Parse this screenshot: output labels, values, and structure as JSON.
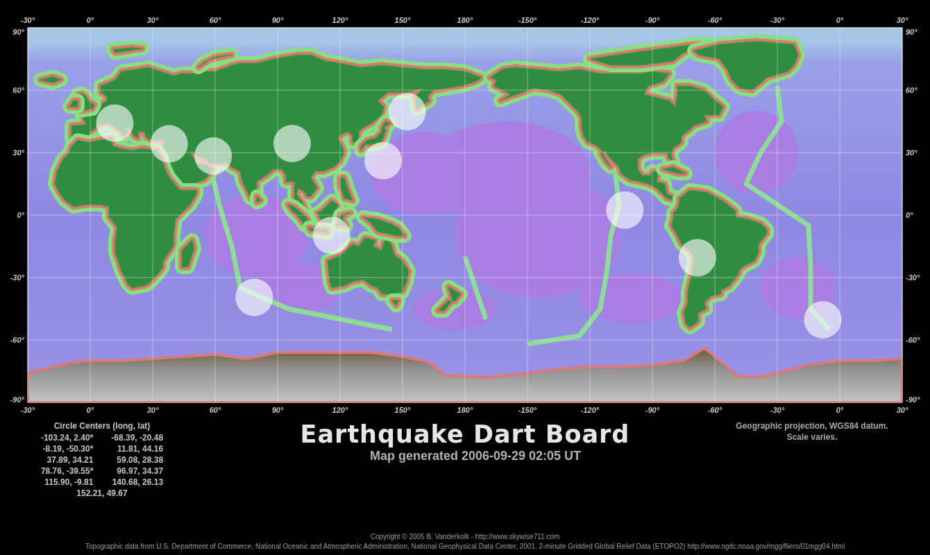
{
  "map": {
    "top_axis_labels": [
      "-30°",
      "0°",
      "30°",
      "60°",
      "90°",
      "120°",
      "150°",
      "180°",
      "-150°",
      "-120°",
      "-90°",
      "-60°",
      "-30°",
      "0°",
      "30°"
    ],
    "bottom_axis_labels": [
      "-30°",
      "0°",
      "30°",
      "60°",
      "90°",
      "120°",
      "150°",
      "180°",
      "-150°",
      "-120°",
      "-90°",
      "-60°",
      "-30°",
      "0°",
      "30°"
    ],
    "left_axis_labels": [
      "90°",
      "60°",
      "30°",
      "0°",
      "-30°",
      "-60°",
      "-90°"
    ],
    "right_axis_labels": [
      "90°",
      "60°",
      "30°",
      "0°",
      "-30°",
      "-60°",
      "-90°"
    ]
  },
  "legend": {
    "title": "Circle Centers (long, lat)",
    "entries": [
      "-103.24, 2.40*",
      "-68.39, -20.48",
      "-8.19, -50.30*",
      "11.81, 44.16",
      "37.89, 34.21",
      "59.08, 28.38",
      "78.76, -39.55*",
      "96.97, 34.37",
      "115.90, -9.81",
      "140.68, 26.13",
      "152.21, 49.67"
    ]
  },
  "title": "Earthquake Dart Board",
  "subtitle": "Map generated 2006-09-29 02:05 UT",
  "projection_note": [
    "Geographic projection, WGS84 datum.",
    "Scale varies."
  ],
  "footer": [
    "Copyright © 2005 B. Vanderkolk - http://www.skywise711.com",
    "Topographic data from U.S. Department of Commerce, National Oceanic and Atmospheric Administration, National Geophysical Data Center, 2001. 2-minute Gridded Global Relief Data (ETOPO2) http://www.ngdc.noaa.gov/mgg/fliers/01mgg04.html"
  ]
}
